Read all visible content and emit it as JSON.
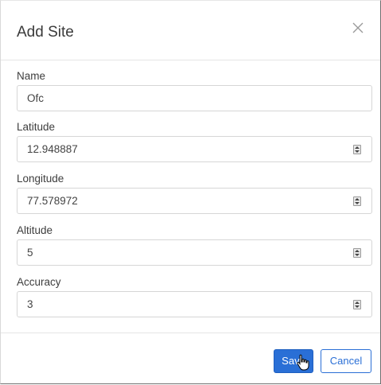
{
  "dialog": {
    "title": "Add Site",
    "close_icon": "close-icon"
  },
  "form": {
    "name": {
      "label": "Name",
      "value": "Ofc"
    },
    "latitude": {
      "label": "Latitude",
      "value": "12.948887"
    },
    "longitude": {
      "label": "Longitude",
      "value": "77.578972"
    },
    "altitude": {
      "label": "Altitude",
      "value": "5"
    },
    "accuracy": {
      "label": "Accuracy",
      "value": "3"
    }
  },
  "footer": {
    "save_label": "Save",
    "cancel_label": "Cancel"
  },
  "colors": {
    "primary": "#2a6fd6",
    "border": "#d6d6d6"
  },
  "icons": {
    "spinner": "number-spinner-icon",
    "cursor": "hand-pointer-icon"
  }
}
